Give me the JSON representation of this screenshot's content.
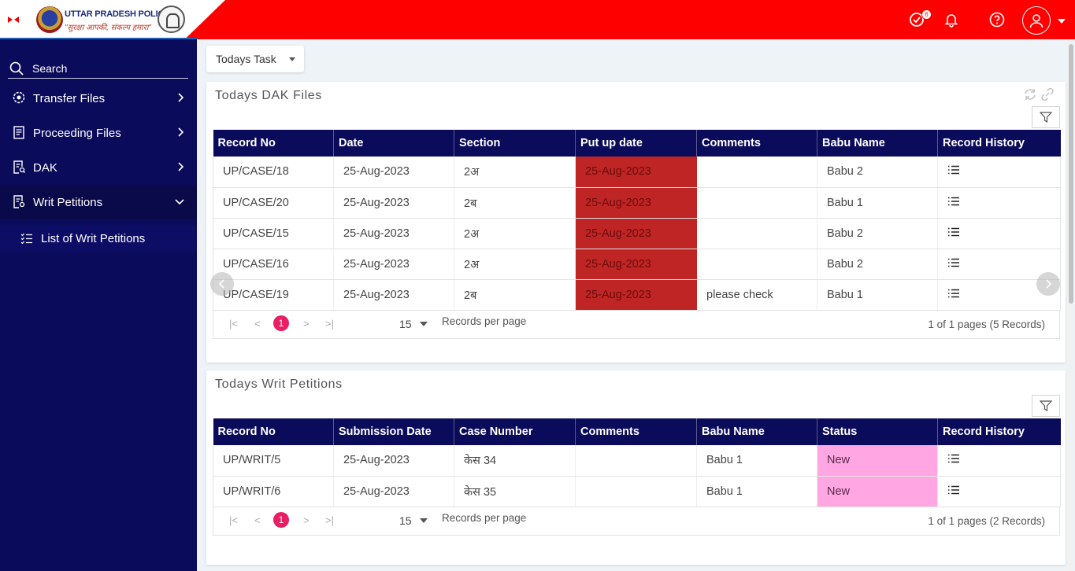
{
  "header": {
    "brand_title": "UTTAR PRADESH POLICE",
    "brand_tagline": "\"सुरक्षा आपकी, संकल्प हमारा\"",
    "tasks_badge": "6",
    "icons": [
      "tasks-check-icon",
      "bell-icon",
      "help-icon",
      "user-avatar-icon"
    ]
  },
  "sidebar": {
    "search_label": "Search",
    "items": [
      {
        "label": "Transfer Files"
      },
      {
        "label": "Proceeding Files"
      },
      {
        "label": "DAK"
      },
      {
        "label": "Writ Petitions"
      }
    ],
    "sub_items": [
      {
        "label": "List of Writ Petitions"
      }
    ]
  },
  "task_select": {
    "value": "Todays Task"
  },
  "dak_card": {
    "title": "Todays DAK Files",
    "columns": [
      "Record No",
      "Date",
      "Section",
      "Put up date",
      "Comments",
      "Babu Name",
      "Record History"
    ],
    "rows": [
      {
        "record_no": "UP/CASE/18",
        "date": "25-Aug-2023",
        "section": "2अ",
        "put_up_date": "25-Aug-2023",
        "comments": "",
        "babu": "Babu 2"
      },
      {
        "record_no": "UP/CASE/20",
        "date": "25-Aug-2023",
        "section": "2ब",
        "put_up_date": "25-Aug-2023",
        "comments": "",
        "babu": "Babu 1"
      },
      {
        "record_no": "UP/CASE/15",
        "date": "25-Aug-2023",
        "section": "2अ",
        "put_up_date": "25-Aug-2023",
        "comments": "",
        "babu": "Babu 2"
      },
      {
        "record_no": "UP/CASE/16",
        "date": "25-Aug-2023",
        "section": "2अ",
        "put_up_date": "25-Aug-2023",
        "comments": "",
        "babu": "Babu 2"
      },
      {
        "record_no": "UP/CASE/19",
        "date": "25-Aug-2023",
        "section": "2ब",
        "put_up_date": "25-Aug-2023",
        "comments": "please check",
        "babu": "Babu 1"
      }
    ],
    "pager": {
      "current_page": "1",
      "page_size": "15",
      "per_page_label": "Records per page",
      "info": "1 of 1 pages (5 Records)"
    }
  },
  "writ_card": {
    "title": "Todays Writ Petitions",
    "columns": [
      "Record No",
      "Submission Date",
      "Case Number",
      "Comments",
      "Babu Name",
      "Status",
      "Record History"
    ],
    "rows": [
      {
        "record_no": "UP/WRIT/5",
        "date": "25-Aug-2023",
        "case_number": "केस 34",
        "comments": "",
        "babu": "Babu 1",
        "status": "New"
      },
      {
        "record_no": "UP/WRIT/6",
        "date": "25-Aug-2023",
        "case_number": "केस 35",
        "comments": "",
        "babu": "Babu 1",
        "status": "New"
      }
    ],
    "pager": {
      "current_page": "1",
      "page_size": "15",
      "per_page_label": "Records per page",
      "info": "1 of 1 pages (2 Records)"
    }
  },
  "colors": {
    "header_red": "#ff0000",
    "sidebar_navy": "#0b0b5b",
    "overdue_red": "#c02525",
    "status_new_pink": "#ffa6e3",
    "page_accent": "#e91e63"
  }
}
